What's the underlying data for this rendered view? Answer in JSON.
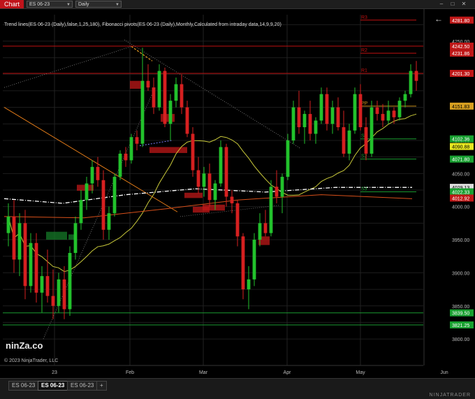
{
  "toolbar": {
    "chart_tab": "Chart",
    "instrument": "ES 06-23",
    "interval": "Daily"
  },
  "indicator_label": "Trend lines(ES 06-23 (Daily),false,1,25,180), Fibonacci pivots(ES 06-23 (Daily),Monthly,Calculated from intraday data,14,9,9,20)",
  "copyright": "© 2023 NinjaTrader, LLC",
  "watermark": "ninZa.co",
  "brand": "NINJATRADER",
  "bottom_tabs": [
    "ES 06-23",
    "ES 06-23",
    "ES 06-23"
  ],
  "add_tab_label": "+",
  "colors": {
    "up": "#22c22c",
    "down": "#d62020",
    "background": "#000000",
    "pivot_resistance": "#c01010",
    "pivot_support": "#1a9a30",
    "pivot_pp": "#c8901a"
  },
  "chart_data": {
    "type": "candlestick",
    "instrument": "ES 06-23",
    "interval": "Daily",
    "ylim": [
      3760,
      4290
    ],
    "yticks": [
      3800,
      3850,
      3900,
      3950,
      4000,
      4050,
      4100,
      4150,
      4200,
      4250
    ],
    "x_tick_labels": [
      "23",
      "Feb",
      "Mar",
      "Apr",
      "May",
      "Jun"
    ],
    "pivot_lines": [
      {
        "label": "R3",
        "value": 4281.8
      },
      {
        "label": "R2",
        "value": 4231.86
      },
      {
        "label": "R1",
        "value": 4201.3
      },
      {
        "label": "PP",
        "value": 4151.83
      },
      {
        "label": "S1",
        "value": 4102.36
      },
      {
        "label": "S2",
        "value": 4071.8
      },
      {
        "label": "S3",
        "value": 4022.33
      }
    ],
    "price_tags": [
      {
        "value": "4281.80",
        "kind": "resistance"
      },
      {
        "value": "4242.50",
        "kind": "resistance"
      },
      {
        "value": "4231.86",
        "kind": "resistance"
      },
      {
        "value": "4201.30",
        "kind": "resistance"
      },
      {
        "value": "4151.83",
        "kind": "pp"
      },
      {
        "value": "4102.36",
        "kind": "support"
      },
      {
        "value": "4090.88",
        "kind": "last"
      },
      {
        "value": "4071.80",
        "kind": "support"
      },
      {
        "value": "4029.13",
        "kind": "ma"
      },
      {
        "value": "4022.33",
        "kind": "support"
      },
      {
        "value": "4012.92",
        "kind": "resistance"
      },
      {
        "value": "3839.50",
        "kind": "support"
      },
      {
        "value": "3821.25",
        "kind": "support"
      }
    ],
    "candles": [
      [
        3960,
        4005,
        3940,
        3985
      ],
      [
        3985,
        4010,
        3900,
        3920
      ],
      [
        3920,
        3990,
        3895,
        3975
      ],
      [
        3975,
        3995,
        3860,
        3880
      ],
      [
        3880,
        3960,
        3870,
        3945
      ],
      [
        3945,
        3960,
        3855,
        3870
      ],
      [
        3870,
        3910,
        3840,
        3895
      ],
      [
        3895,
        3935,
        3855,
        3865
      ],
      [
        3865,
        3905,
        3830,
        3850
      ],
      [
        3850,
        3900,
        3840,
        3890
      ],
      [
        3890,
        3910,
        3830,
        3845
      ],
      [
        3845,
        3940,
        3835,
        3930
      ],
      [
        3930,
        3985,
        3920,
        3975
      ],
      [
        3975,
        4025,
        3965,
        4010
      ],
      [
        4010,
        4045,
        3995,
        4035
      ],
      [
        4035,
        4070,
        4020,
        4060
      ],
      [
        4060,
        4075,
        4030,
        4040
      ],
      [
        4040,
        4055,
        3950,
        3965
      ],
      [
        3965,
        4000,
        3950,
        3990
      ],
      [
        3990,
        4050,
        3985,
        4045
      ],
      [
        4045,
        4085,
        4040,
        4080
      ],
      [
        4080,
        4090,
        4060,
        4070
      ],
      [
        4070,
        4110,
        4065,
        4105
      ],
      [
        4105,
        4115,
        4085,
        4095
      ],
      [
        4095,
        4240,
        4090,
        4190
      ],
      [
        4190,
        4215,
        4175,
        4180
      ],
      [
        4180,
        4195,
        4140,
        4150
      ],
      [
        4150,
        4215,
        4145,
        4205
      ],
      [
        4205,
        4210,
        4120,
        4125
      ],
      [
        4125,
        4170,
        4100,
        4160
      ],
      [
        4160,
        4195,
        4150,
        4185
      ],
      [
        4185,
        4200,
        4140,
        4150
      ],
      [
        4150,
        4160,
        4105,
        4110
      ],
      [
        4110,
        4120,
        4045,
        4055
      ],
      [
        4055,
        4075,
        4020,
        4030
      ],
      [
        4030,
        4060,
        4015,
        4050
      ],
      [
        4050,
        4065,
        4000,
        4010
      ],
      [
        4010,
        4040,
        3995,
        4035
      ],
      [
        4035,
        4100,
        4030,
        4090
      ],
      [
        4090,
        4095,
        4000,
        4015
      ],
      [
        4015,
        4025,
        3990,
        4005
      ],
      [
        4005,
        4010,
        3940,
        3955
      ],
      [
        3955,
        3960,
        3860,
        3875
      ],
      [
        3875,
        3910,
        3845,
        3890
      ],
      [
        3890,
        3960,
        3880,
        3950
      ],
      [
        3950,
        3990,
        3940,
        3975
      ],
      [
        3975,
        3995,
        3955,
        3960
      ],
      [
        3960,
        4040,
        3955,
        4030
      ],
      [
        4030,
        4055,
        4005,
        4015
      ],
      [
        4015,
        4050,
        3990,
        4045
      ],
      [
        4045,
        4110,
        4040,
        4100
      ],
      [
        4100,
        4160,
        4095,
        4150
      ],
      [
        4150,
        4175,
        4110,
        4120
      ],
      [
        4120,
        4145,
        4095,
        4140
      ],
      [
        4140,
        4160,
        4100,
        4110
      ],
      [
        4110,
        4135,
        4095,
        4130
      ],
      [
        4130,
        4180,
        4125,
        4170
      ],
      [
        4170,
        4180,
        4115,
        4125
      ],
      [
        4125,
        4160,
        4110,
        4150
      ],
      [
        4150,
        4165,
        4115,
        4120
      ],
      [
        4120,
        4145,
        4075,
        4080
      ],
      [
        4080,
        4125,
        4070,
        4115
      ],
      [
        4115,
        4180,
        4110,
        4170
      ],
      [
        4170,
        4185,
        4115,
        4120
      ],
      [
        4120,
        4135,
        4070,
        4080
      ],
      [
        4080,
        4160,
        4075,
        4150
      ],
      [
        4150,
        4160,
        4130,
        4140
      ],
      [
        4140,
        4155,
        4120,
        4130
      ],
      [
        4130,
        4160,
        4125,
        4145
      ],
      [
        4145,
        4150,
        4125,
        4135
      ],
      [
        4135,
        4165,
        4130,
        4160
      ],
      [
        4160,
        4175,
        4150,
        4170
      ],
      [
        4170,
        4215,
        4165,
        4205
      ],
      [
        4205,
        4220,
        4175,
        4190
      ]
    ]
  }
}
